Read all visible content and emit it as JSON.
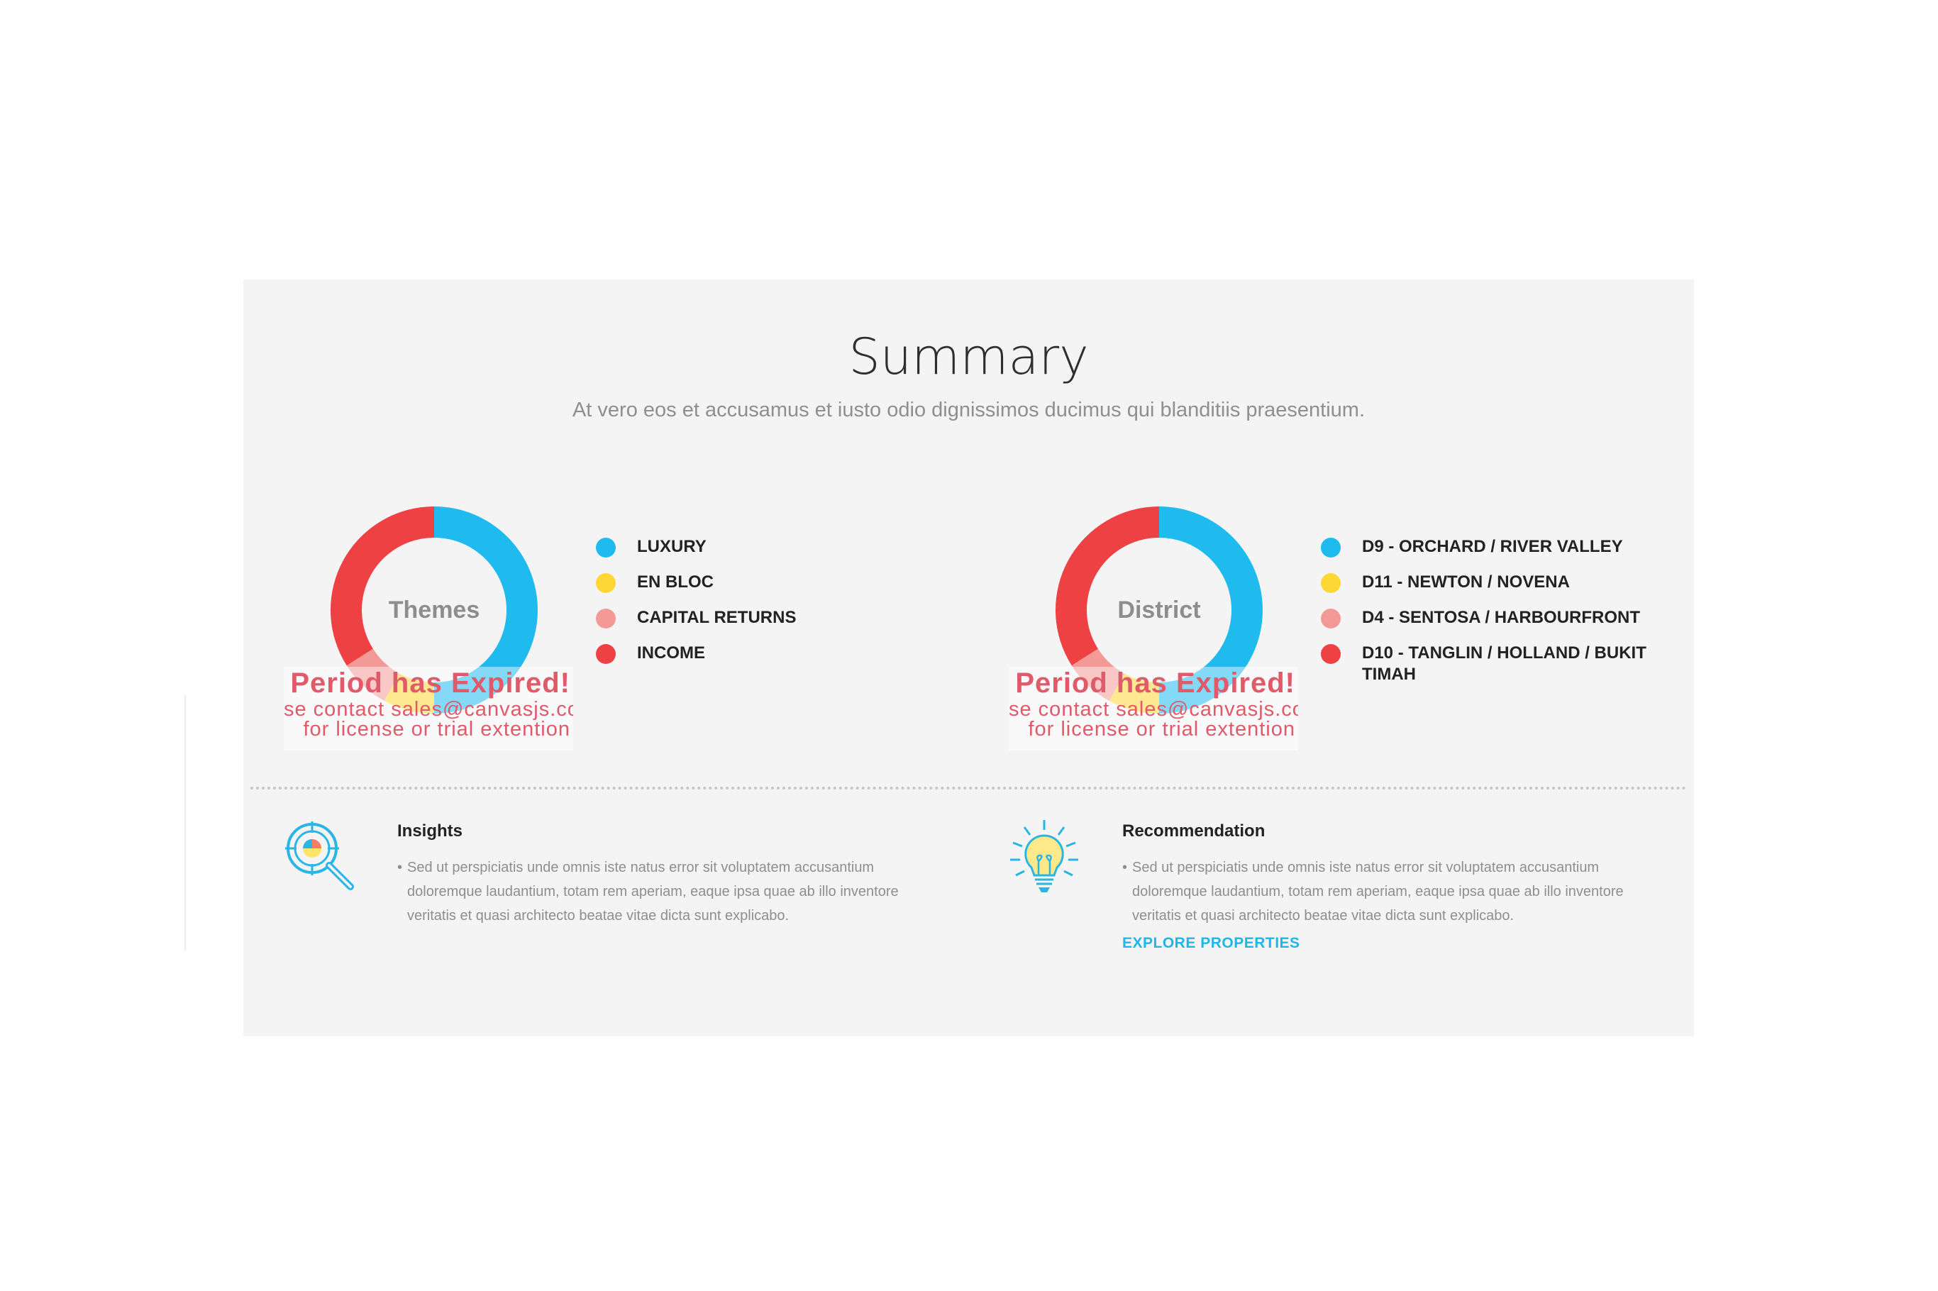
{
  "summary": {
    "title": "Summary",
    "subtitle": "At vero eos et accusamus et iusto odio dignissimos ducimus qui blanditiis praesentium."
  },
  "colors": {
    "blue": "#1fbbee",
    "yellow": "#fdd835",
    "pink": "#f49a96",
    "red": "#ee4144",
    "panel": "#f4f4f4",
    "accent_link": "#1eb7e8"
  },
  "watermark": {
    "line1": "Period has Expired!",
    "line2": "se contact sales@canvasjs.com",
    "line3": "for license or trial extention"
  },
  "charts": [
    {
      "center_label": "Themes",
      "legend": [
        {
          "label": "LUXURY",
          "color": "#1fbbee"
        },
        {
          "label": "EN BLOC",
          "color": "#fdd835"
        },
        {
          "label": "CAPITAL RETURNS",
          "color": "#f49a96"
        },
        {
          "label": "INCOME",
          "color": "#ee4144"
        }
      ]
    },
    {
      "center_label": "District",
      "legend": [
        {
          "label": "D9 - ORCHARD / RIVER VALLEY",
          "color": "#1fbbee"
        },
        {
          "label": "D11 - NEWTON / NOVENA",
          "color": "#fdd835"
        },
        {
          "label": "D4 - SENTOSA / HARBOURFRONT",
          "color": "#f49a96"
        },
        {
          "label": "D10 - TANGLIN / HOLLAND / BUKIT TIMAH",
          "color": "#ee4144"
        }
      ]
    }
  ],
  "chart_data": [
    {
      "type": "pie",
      "categories": [
        "LUXURY",
        "EN BLOC",
        "CAPITAL RETURNS",
        "INCOME"
      ],
      "values": [
        50,
        8,
        8,
        34
      ],
      "colors": [
        "#1fbbee",
        "#fdd835",
        "#f49a96",
        "#ee4144"
      ],
      "title": "Themes"
    },
    {
      "type": "pie",
      "categories": [
        "D9 - ORCHARD / RIVER VALLEY",
        "D11 - NEWTON / NOVENA",
        "D4 - SENTOSA / HARBOURFRONT",
        "D10 - TANGLIN / HOLLAND / BUKIT TIMAH"
      ],
      "values": [
        50,
        8,
        8,
        34
      ],
      "colors": [
        "#1fbbee",
        "#fdd835",
        "#f49a96",
        "#ee4144"
      ],
      "title": "District"
    }
  ],
  "insights": {
    "heading": "Insights",
    "body": "Sed ut perspiciatis unde omnis iste natus error sit voluptatem accusantium doloremque laudantium, totam rem aperiam, eaque ipsa quae ab illo inventore veritatis et quasi architecto beatae vitae dicta sunt explicabo.",
    "icon": "magnifier-chart-icon"
  },
  "recommendation": {
    "heading": "Recommendation",
    "body": "Sed ut perspiciatis unde omnis iste natus error sit voluptatem accusantium doloremque laudantium, totam rem aperiam, eaque ipsa quae ab illo inventore veritatis et quasi architecto beatae vitae dicta sunt explicabo.",
    "link": "EXPLORE PROPERTIES",
    "icon": "lightbulb-icon"
  }
}
